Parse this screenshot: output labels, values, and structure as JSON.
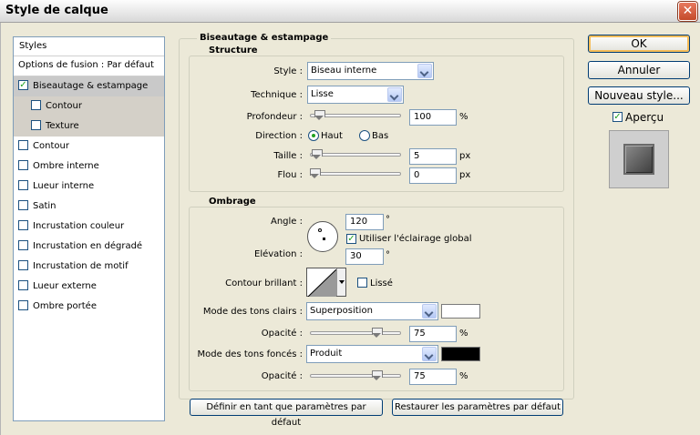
{
  "window": {
    "title": "Style de calque",
    "close_glyph": "✕"
  },
  "styles_panel": {
    "header": "Styles",
    "blending_options": "Options de fusion : Par défaut",
    "items": [
      {
        "label": "Biseautage & estampage",
        "checked": true,
        "selected": true
      },
      {
        "label": "Contour",
        "checked": false,
        "sub": true
      },
      {
        "label": "Texture",
        "checked": false,
        "sub": true
      },
      {
        "label": "Contour",
        "checked": false
      },
      {
        "label": "Ombre interne",
        "checked": false
      },
      {
        "label": "Lueur interne",
        "checked": false
      },
      {
        "label": "Satin",
        "checked": false
      },
      {
        "label": "Incrustation couleur",
        "checked": false
      },
      {
        "label": "Incrustation en dégradé",
        "checked": false
      },
      {
        "label": "Incrustation de motif",
        "checked": false
      },
      {
        "label": "Lueur externe",
        "checked": false
      },
      {
        "label": "Ombre portée",
        "checked": false
      }
    ]
  },
  "bevel": {
    "group_title": "Biseautage & estampage",
    "structure": {
      "title": "Structure",
      "style_label": "Style :",
      "style_value": "Biseau interne",
      "technique_label": "Technique :",
      "technique_value": "Lisse",
      "depth_label": "Profondeur :",
      "depth_value": "100",
      "depth_unit": "%",
      "depth_level": 0.05,
      "direction_label": "Direction :",
      "direction_up": "Haut",
      "direction_down": "Bas",
      "size_label": "Taille :",
      "size_value": "5",
      "size_unit": "px",
      "size_level": 0.02,
      "soften_label": "Flou :",
      "soften_value": "0",
      "soften_unit": "px",
      "soften_level": 0.0
    },
    "shading": {
      "title": "Ombrage",
      "angle_label": "Angle :",
      "angle_value": "120",
      "angle_unit": "°",
      "global_light_label": "Utiliser l'éclairage global",
      "global_light_checked": true,
      "altitude_label": "Elévation :",
      "altitude_value": "30",
      "altitude_unit": "°",
      "gloss_contour_label": "Contour brillant :",
      "antialias_label": "Lissé",
      "antialias_checked": false,
      "highlight_mode_label": "Mode des tons clairs :",
      "highlight_mode_value": "Superposition",
      "highlight_color": "#ffffff",
      "highlight_opacity_label": "Opacité :",
      "highlight_opacity_value": "75",
      "highlight_opacity_unit": "%",
      "highlight_opacity_level": 0.75,
      "shadow_mode_label": "Mode des tons foncés :",
      "shadow_mode_value": "Produit",
      "shadow_color": "#000000",
      "shadow_opacity_label": "Opacité :",
      "shadow_opacity_value": "75",
      "shadow_opacity_unit": "%",
      "shadow_opacity_level": 0.75
    },
    "make_default": "Définir en tant que paramètres par défaut",
    "reset_default": "Restaurer les paramètres par défaut"
  },
  "actions": {
    "ok": "OK",
    "cancel": "Annuler",
    "new_style": "Nouveau style...",
    "preview_label": "Aperçu",
    "preview_checked": true
  }
}
